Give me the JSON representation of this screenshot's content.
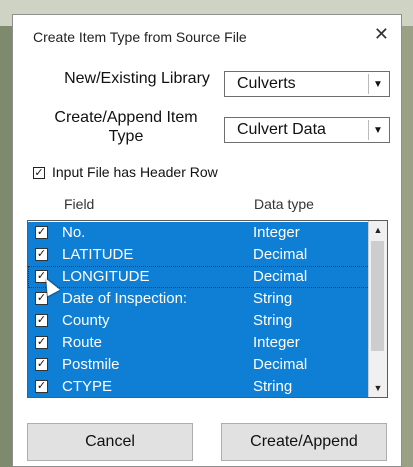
{
  "dialog": {
    "title": "Create Item Type from Source File",
    "close_glyph": "✕"
  },
  "library": {
    "label": "New/Existing Library",
    "value": "Culverts",
    "arrow": "▼"
  },
  "item_type": {
    "label_line1": "Create/Append Item",
    "label_line2": "Type",
    "value": "Culvert Data",
    "arrow": "▼"
  },
  "header_row": {
    "checked": true,
    "check_glyph": "✓",
    "label": "Input File has Header Row"
  },
  "columns": {
    "field": "Field",
    "data_type": "Data type"
  },
  "rows": [
    {
      "field": "No.",
      "type": "Integer",
      "checked": true
    },
    {
      "field": "LATITUDE",
      "type": "Decimal",
      "checked": true
    },
    {
      "field": "LONGITUDE",
      "type": "Decimal",
      "checked": true
    },
    {
      "field": "Date of Inspection:",
      "type": "String",
      "checked": true
    },
    {
      "field": "County",
      "type": "String",
      "checked": true
    },
    {
      "field": "Route",
      "type": "Integer",
      "checked": true
    },
    {
      "field": "Postmile",
      "type": "Decimal",
      "checked": true
    },
    {
      "field": "CTYPE",
      "type": "String",
      "checked": true
    }
  ],
  "scrollbar": {
    "up": "▲",
    "down": "▼"
  },
  "buttons": {
    "cancel": "Cancel",
    "create": "Create/Append"
  },
  "colors": {
    "selection": "#0f7fd6",
    "button_bg": "#e1e1e1"
  }
}
